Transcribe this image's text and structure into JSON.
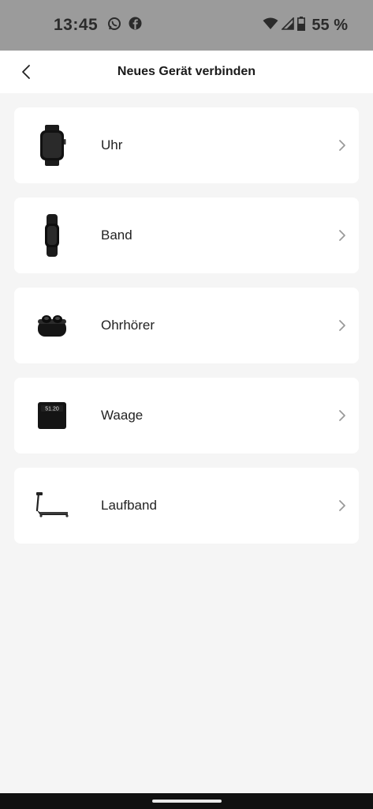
{
  "status_bar": {
    "time": "13:45",
    "battery_text": "55 %",
    "notification_icons": [
      "whatsapp-icon",
      "facebook-icon"
    ],
    "system_icons": [
      "wifi-icon",
      "cell-signal-icon",
      "battery-icon"
    ]
  },
  "header": {
    "title": "Neues Gerät verbinden",
    "back_icon": "chevron-left-icon"
  },
  "devices": [
    {
      "label": "Uhr",
      "icon": "smartwatch-icon"
    },
    {
      "label": "Band",
      "icon": "fitness-band-icon"
    },
    {
      "label": "Ohrhörer",
      "icon": "earbuds-icon"
    },
    {
      "label": "Waage",
      "icon": "scale-icon",
      "display_text": "51.20"
    },
    {
      "label": "Laufband",
      "icon": "treadmill-icon"
    }
  ],
  "colors": {
    "status_bar_bg": "#9b9b9b",
    "page_bg": "#f5f5f5",
    "card_bg": "#ffffff",
    "chevron": "#9a9a9a"
  }
}
